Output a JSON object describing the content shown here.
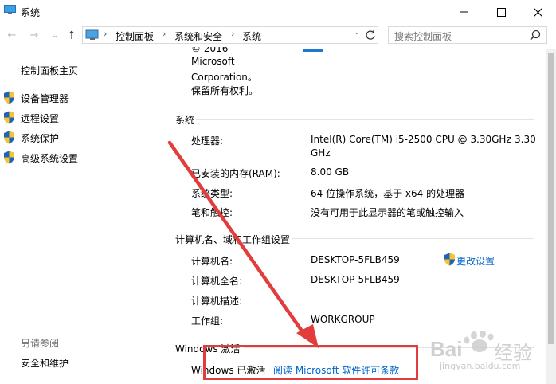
{
  "window": {
    "title": "系统"
  },
  "breadcrumb": [
    "控制面板",
    "系统和安全",
    "系统"
  ],
  "search": {
    "placeholder": "搜索控制面板"
  },
  "sidebar": {
    "home": "控制面板主页",
    "items": [
      {
        "label": "设备管理器",
        "icon": "shield-icon"
      },
      {
        "label": "远程设置",
        "icon": "shield-icon"
      },
      {
        "label": "系统保护",
        "icon": "shield-icon"
      },
      {
        "label": "高级系统设置",
        "icon": "shield-icon"
      }
    ],
    "see_also": {
      "heading": "另请参阅",
      "link": "安全和维护"
    }
  },
  "copyright": {
    "line1": "© 2016",
    "line2": "Microsoft",
    "line3": "Corporation。",
    "line4": "保留所有权利。"
  },
  "system": {
    "heading": "系统",
    "rows": [
      {
        "label": "处理器:",
        "value": "Intel(R) Core(TM) i5-2500 CPU @ 3.30GHz",
        "value_extra": "3.30",
        "value_line2": "GHz"
      },
      {
        "label": "已安装的内存(RAM):",
        "value": "8.00 GB"
      },
      {
        "label": "系统类型:",
        "value": "64 位操作系统，基于 x64 的处理器"
      },
      {
        "label": "笔和触控:",
        "value": "没有可用于此显示器的笔或触控输入"
      }
    ]
  },
  "computer": {
    "heading": "计算机名、域和工作组设置",
    "change_link": "更改设置",
    "rows": [
      {
        "label": "计算机名:",
        "value": "DESKTOP-5FLB459"
      },
      {
        "label": "计算机全名:",
        "value": "DESKTOP-5FLB459"
      },
      {
        "label": "计算机描述:",
        "value": ""
      },
      {
        "label": "工作组:",
        "value": "WORKGROUP"
      }
    ]
  },
  "activation": {
    "heading": "Windows 激活",
    "status": "Windows 已激活",
    "license_link": "阅读 Microsoft 软件许可条款"
  },
  "watermark": {
    "brand": "Bai",
    "brand2": "经验",
    "url": "jingyan.baidu.com"
  },
  "colors": {
    "link": "#0066cc",
    "annotation": "#e23c3c",
    "shield_blue": "#1e63b8",
    "shield_yellow": "#f4c531"
  }
}
